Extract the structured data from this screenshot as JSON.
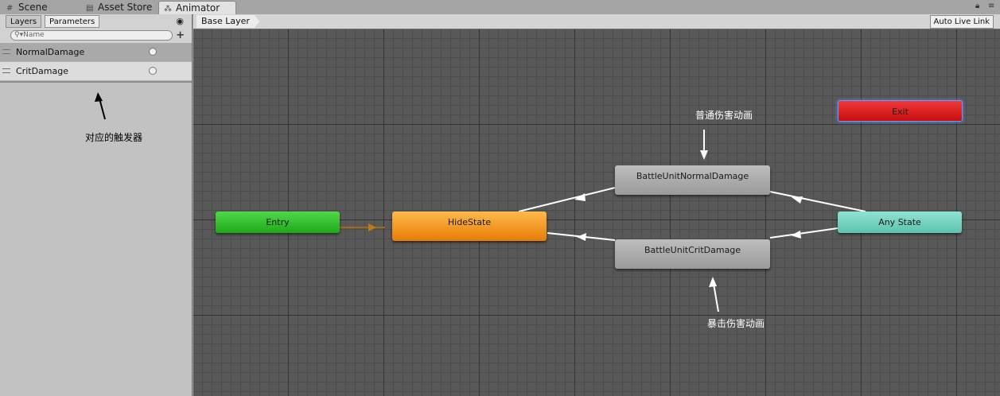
{
  "window_tabs": [
    {
      "label": "Scene",
      "icon": "grid-icon"
    },
    {
      "label": "Asset Store",
      "icon": "store-icon"
    },
    {
      "label": "Animator",
      "icon": "animator-icon"
    }
  ],
  "left_panel": {
    "tabs": [
      "Layers",
      "Parameters"
    ],
    "search_placeholder": "Name",
    "parameters": [
      {
        "name": "NormalDamage",
        "type": "trigger"
      },
      {
        "name": "CritDamage",
        "type": "trigger"
      }
    ],
    "annotation": "对应的触发器"
  },
  "graph": {
    "breadcrumb": "Base Layer",
    "auto_live_link": "Auto Live Link",
    "nodes": {
      "entry": "Entry",
      "hide": "HideState",
      "normal": "BattleUnitNormalDamage",
      "crit": "BattleUnitCritDamage",
      "any": "Any State",
      "exit": "Exit"
    },
    "annotations": {
      "normal": "普通伤害动画",
      "crit": "暴击伤害动画"
    }
  },
  "colors": {
    "entry": "#2ec428",
    "hide": "#f39a1e",
    "any": "#73d3bf",
    "exit": "#e01d1d",
    "state": "#a9a9a9",
    "grid": "#585858"
  }
}
